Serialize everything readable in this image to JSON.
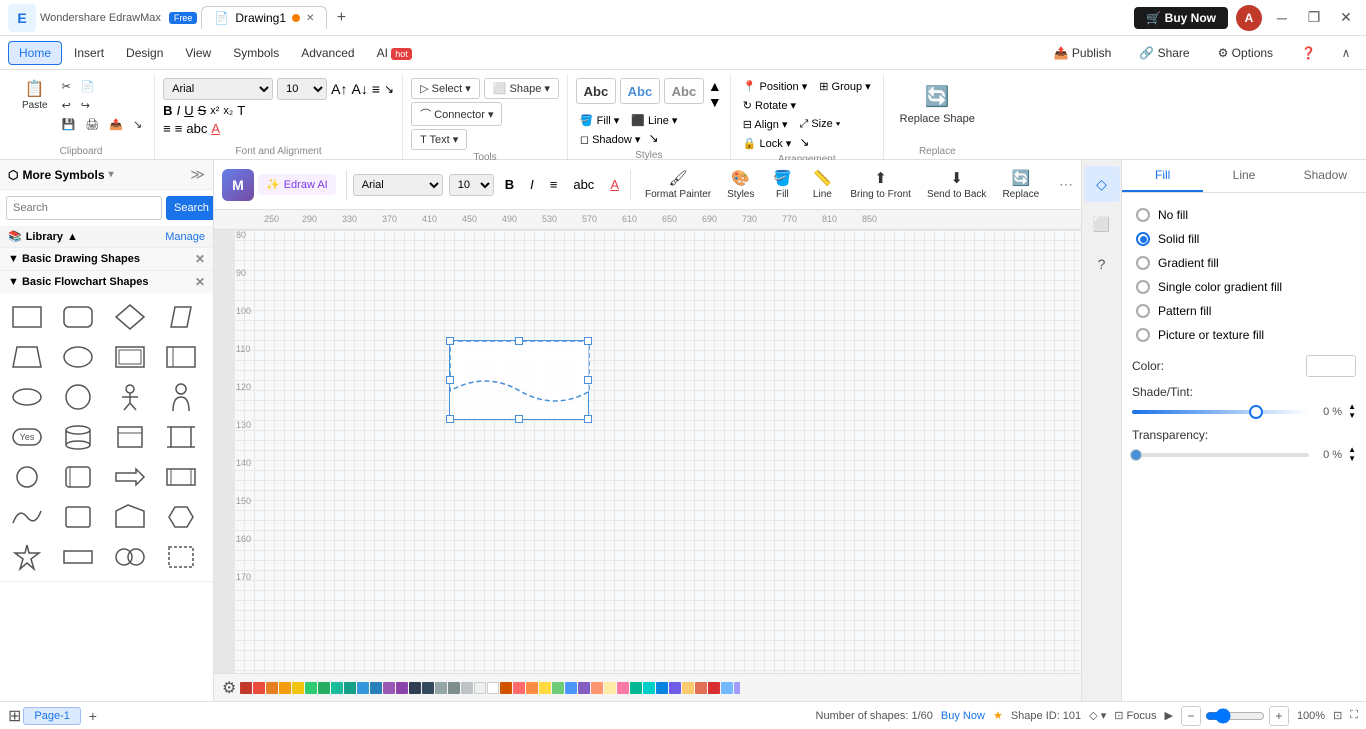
{
  "titleBar": {
    "appName": "Wondershare EdrawMax",
    "freeBadge": "Free",
    "tabName": "Drawing1",
    "addTabLabel": "+",
    "buyNowLabel": "Buy Now",
    "userInitial": "A",
    "minimizeIcon": "─",
    "maximizeIcon": "❐",
    "closeIcon": "✕"
  },
  "menuBar": {
    "items": [
      "Home",
      "Insert",
      "Design",
      "View",
      "Symbols",
      "Advanced"
    ],
    "aiLabel": "AI",
    "aiBadge": "hot",
    "publishLabel": "Publish",
    "shareLabel": "Share",
    "optionsLabel": "Options",
    "helpLabel": "?",
    "collapseLabel": "∧"
  },
  "ribbon": {
    "clipboard": {
      "label": "Clipboard",
      "pasteLabel": "Paste",
      "cutLabel": "Cut",
      "formatLabel": "Format",
      "copyLabel": "Copy",
      "undoLabel": "Undo",
      "redoLabel": "Redo",
      "saveLabel": "Save",
      "printLabel": "Print",
      "exportLabel": "Export"
    },
    "fontAlignment": {
      "label": "Font and Alignment",
      "fontName": "Arial",
      "fontSize": "10",
      "boldLabel": "B",
      "italicLabel": "I",
      "underlineLabel": "U",
      "strikeLabel": "S",
      "superLabel": "x²",
      "subLabel": "x₂",
      "textLabel": "T",
      "numberedLabel": "≡",
      "bulletLabel": "≡",
      "abcLabel": "abc",
      "fontColorLabel": "A",
      "alignLabel": "≡",
      "fontUpLabel": "A↑",
      "fontDownLabel": "A↓"
    },
    "tools": {
      "label": "Tools",
      "selectLabel": "Select ▾",
      "shapeLabel": "Shape ▾",
      "connectorLabel": "Connector ▾",
      "textLabel": "Text ▾"
    },
    "styles": {
      "label": "Styles",
      "fillLabel": "Fill ▾",
      "lineLabel": "Line ▾",
      "shadowLabel": "Shadow ▾",
      "abcSamples": [
        "Abc",
        "Abc",
        "Abc"
      ]
    },
    "arrangement": {
      "label": "Arrangement",
      "positionLabel": "Position ▾",
      "groupLabel": "Group ▾",
      "rotateLabel": "Rotate ▾",
      "alignLabel": "Align ▾",
      "sizeLabel": "Size ▾",
      "lockLabel": "Lock ▾"
    },
    "replace": {
      "label": "Replace",
      "replaceShapeLabel": "Replace Shape"
    }
  },
  "leftPanel": {
    "title": "More Symbols",
    "collapseLabel": "≫",
    "searchPlaceholder": "Search",
    "searchButtonLabel": "Search",
    "libraryLabel": "Library",
    "manageLabel": "Manage",
    "sections": [
      {
        "name": "Basic Drawing Shapes",
        "expanded": true
      },
      {
        "name": "Basic Flowchart Shapes",
        "expanded": true
      }
    ]
  },
  "floatingToolbar": {
    "formatPainterLabel": "Format Painter",
    "stylesLabel": "Styles",
    "fillLabel": "Fill",
    "lineLabel": "Line",
    "bringToFrontLabel": "Bring to Front",
    "sendToBackLabel": "Send to Back",
    "replaceLabel": "Replace"
  },
  "rightPanel": {
    "tabs": [
      "Fill",
      "Line",
      "Shadow"
    ],
    "activeTab": "Fill",
    "fillOptions": [
      {
        "label": "No fill",
        "checked": false
      },
      {
        "label": "Solid fill",
        "checked": true
      },
      {
        "label": "Gradient fill",
        "checked": false
      },
      {
        "label": "Single color gradient fill",
        "checked": false
      },
      {
        "label": "Pattern fill",
        "checked": false
      },
      {
        "label": "Picture or texture fill",
        "checked": false
      }
    ],
    "colorLabel": "Color:",
    "shadeTintLabel": "Shade/Tint:",
    "shadeTintValue": "0 %",
    "transparencyLabel": "Transparency:",
    "transparencyValue": "0 %"
  },
  "rightSidebar": {
    "icons": [
      "◇",
      "⬜",
      "?"
    ]
  },
  "statusBar": {
    "shapesInfo": "Number of shapes: 1/60",
    "buyNowLabel": "Buy Now",
    "shapeIdLabel": "Shape ID: 101",
    "focusLabel": "Focus",
    "zoomOutLabel": "−",
    "zoomInLabel": "+",
    "zoomLevel": "100%",
    "fitLabel": "⊡",
    "pageLabel": "Page-1",
    "colors": [
      "#c0392b",
      "#e74c3c",
      "#e67e22",
      "#f39c12",
      "#f1c40f",
      "#2ecc71",
      "#27ae60",
      "#1abc9c",
      "#16a085",
      "#3498db",
      "#2980b9",
      "#9b59b6",
      "#8e44ad",
      "#2c3e50",
      "#34495e",
      "#95a5a6",
      "#7f8c8d",
      "#bdc3c7",
      "#ecf0f1",
      "#fff",
      "#d35400",
      "#c0392b",
      "#ff6b6b",
      "#ff8c42",
      "#ffd93d",
      "#6bcb77",
      "#4d96ff",
      "#845ec2",
      "#ff9671",
      "#ffeaa7",
      "#fd79a8",
      "#00b894",
      "#00cec9",
      "#0984e3",
      "#6c5ce7",
      "#fdcb6e",
      "#e17055",
      "#d63031",
      "#74b9ff",
      "#a29bfe",
      "#55efc4",
      "#81ecec",
      "#fab1a0",
      "#e84393",
      "#2d3436",
      "#636e72",
      "#b2bec3",
      "#dfe6e9",
      "#000",
      "#333",
      "#555",
      "#888",
      "#aaa",
      "#ccc",
      "#ddd",
      "#eee",
      "#fff0",
      "#f8f9fa",
      "#ff7675",
      "#fd79a8",
      "#e84393"
    ]
  },
  "canvas": {
    "edrawAiLabel": "Edraw AI",
    "rulerNumbers": [
      "250",
      "290",
      "330",
      "370",
      "410",
      "450",
      "490",
      "530",
      "570",
      "610",
      "650",
      "690",
      "730",
      "770",
      "810",
      "850"
    ],
    "vRulerNumbers": [
      "80",
      "90",
      "100",
      "110",
      "120",
      "130",
      "140",
      "150",
      "160",
      "170"
    ],
    "pageTabLabel": "Page-1",
    "addPageLabel": "+"
  }
}
